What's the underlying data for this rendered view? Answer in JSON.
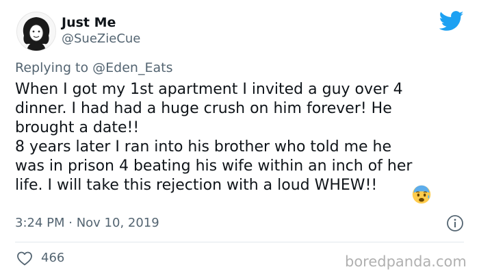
{
  "author": {
    "display_name": "Just Me",
    "handle": "@SueZieCue"
  },
  "reply": {
    "prefix": "Replying to",
    "mention": "@Eden_Eats"
  },
  "tweet": {
    "text": "When I got my 1st apartment I invited a guy over 4\ndinner. I had had a huge crush on him forever! He\nbrought a date!!\n8 years later I ran into his brother who told me he\nwas in prison 4 beating his wife within an inch of her\nlife. I will take this rejection with a loud WHEW!!",
    "emoji": "anxious-face-with-sweat",
    "timestamp": "3:24 PM · Nov 10, 2019",
    "likes": "466"
  },
  "icons": {
    "logo": "twitter-bird-icon",
    "info": "info-icon",
    "like": "heart-icon"
  },
  "colors": {
    "twitter_blue": "#1da1f2",
    "text_primary": "#0f1419",
    "text_secondary": "#536471"
  },
  "watermark": "boredpanda.com"
}
